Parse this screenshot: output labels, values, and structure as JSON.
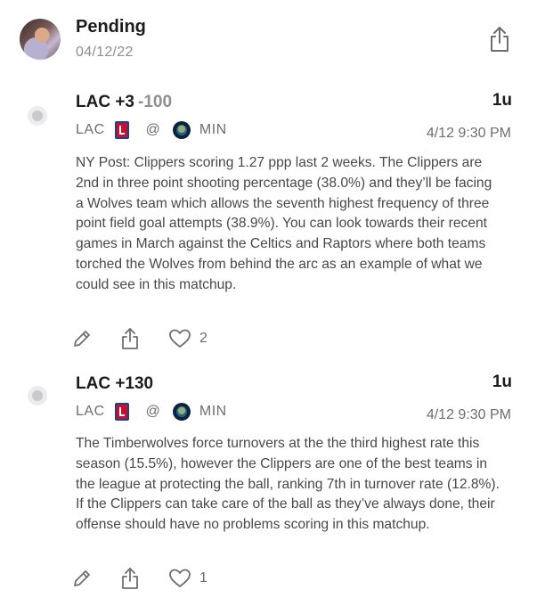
{
  "header": {
    "status": "Pending",
    "date": "04/12/22"
  },
  "picks": [
    {
      "bet": "LAC +3",
      "odds": "-100",
      "units": "1u",
      "away_team": "LAC",
      "at": "@",
      "home_team": "MIN",
      "game_time": "4/12 9:30 PM",
      "description": "NY Post: Clippers scoring 1.27 ppp last 2 weeks. The Clippers are 2nd in three point shooting percentage (38.0%) and they’ll be facing a Wolves team which allows the seventh highest frequency of three point field goal attempts (38.9%). You can look towards their recent games in March against the Celtics and Raptors where both teams torched the Wolves from behind the arc as an example of what we could see in this matchup.",
      "likes": "2"
    },
    {
      "bet": "LAC +130",
      "odds": "",
      "units": "1u",
      "away_team": "LAC",
      "at": "@",
      "home_team": "MIN",
      "game_time": "4/12 9:30 PM",
      "description": "The Timberwolves force turnovers at the the third highest rate this season (15.5%), however the Clippers are one of the best teams in the league at protecting the ball, ranking 7th in turnover rate (12.8%). If the Clippers can take care of the ball as they’ve always done, their offense should have no problems scoring in this matchup.",
      "likes": "1"
    }
  ],
  "icons": {
    "header_share": "share-icon",
    "edit": "pencil-icon",
    "share": "share-icon",
    "like": "heart-icon",
    "away_logo": "clippers-logo-icon",
    "home_logo": "timberwolves-logo-icon"
  },
  "colors": {
    "text_primary": "#1c1c1e",
    "text_secondary": "#8e8e93",
    "clippers_red": "#c8102e",
    "clippers_blue": "#1d428a",
    "wolves_navy": "#0c2340"
  }
}
